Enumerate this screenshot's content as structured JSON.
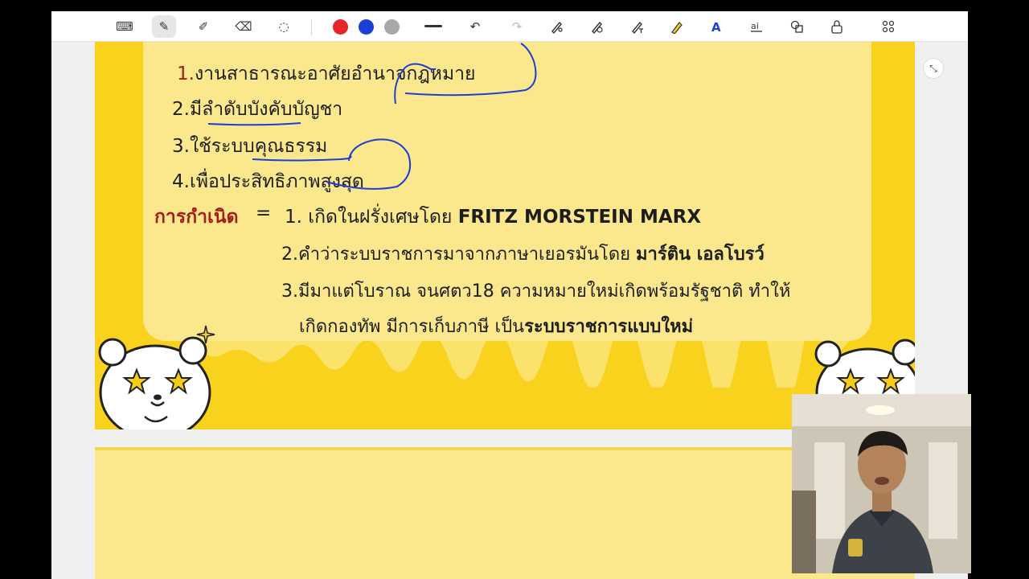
{
  "toolbar": {
    "tools": [
      {
        "name": "keyboard-icon",
        "glyph": "⌨"
      },
      {
        "name": "pen-icon",
        "glyph": "✎",
        "active": true
      },
      {
        "name": "highlighter-icon",
        "glyph": "✐"
      },
      {
        "name": "eraser-icon",
        "glyph": "⌫"
      },
      {
        "name": "lasso-icon",
        "glyph": "◌"
      }
    ],
    "colors": [
      "#e5252a",
      "#1b3fd4",
      "#a8a8a8"
    ],
    "undo_glyph": "↶",
    "redo_glyph": "↷"
  },
  "slide": {
    "list": [
      {
        "num": "1.",
        "text": "งานสาธารณะอาศัยอำนาจกฎหมาย"
      },
      {
        "num": "2.",
        "text": "มีลำดับบังคับบัญชา"
      },
      {
        "num": "3.",
        "text": "ใช้ระบบคุณธรรม"
      },
      {
        "num": "4.",
        "text": "เพื่อประสิทธิภาพสูงสุด"
      }
    ],
    "origin_label": "การกำเนิด",
    "equals": "=",
    "origin_1_prefix": "1. เกิดในฝรั่งเศษโดย",
    "origin_1_bold": "FRITZ MORSTEIN MARX",
    "origin_2_prefix": "2.คำว่าระบบราชการมาจากภาษาเยอรมันโดย",
    "origin_2_bold": "มาร์ติน เอลโบรว์",
    "origin_3_line1": "3.มีมาแต่โบราณ จนศตว18 ความหมายใหม่เกิดพร้อมรัฐชาติ ทำให้",
    "origin_3_line2_prefix": "เกิดกองทัพ มีการเก็บภาษี เป็น",
    "origin_3_line2_bold": "ระบบราชการแบบใหม่"
  },
  "colors": {
    "page_yellow": "#f8d21c",
    "panel_yellow": "#fbe88d",
    "heading_red": "#a31d1d",
    "ink_blue": "#1b3fd4"
  }
}
